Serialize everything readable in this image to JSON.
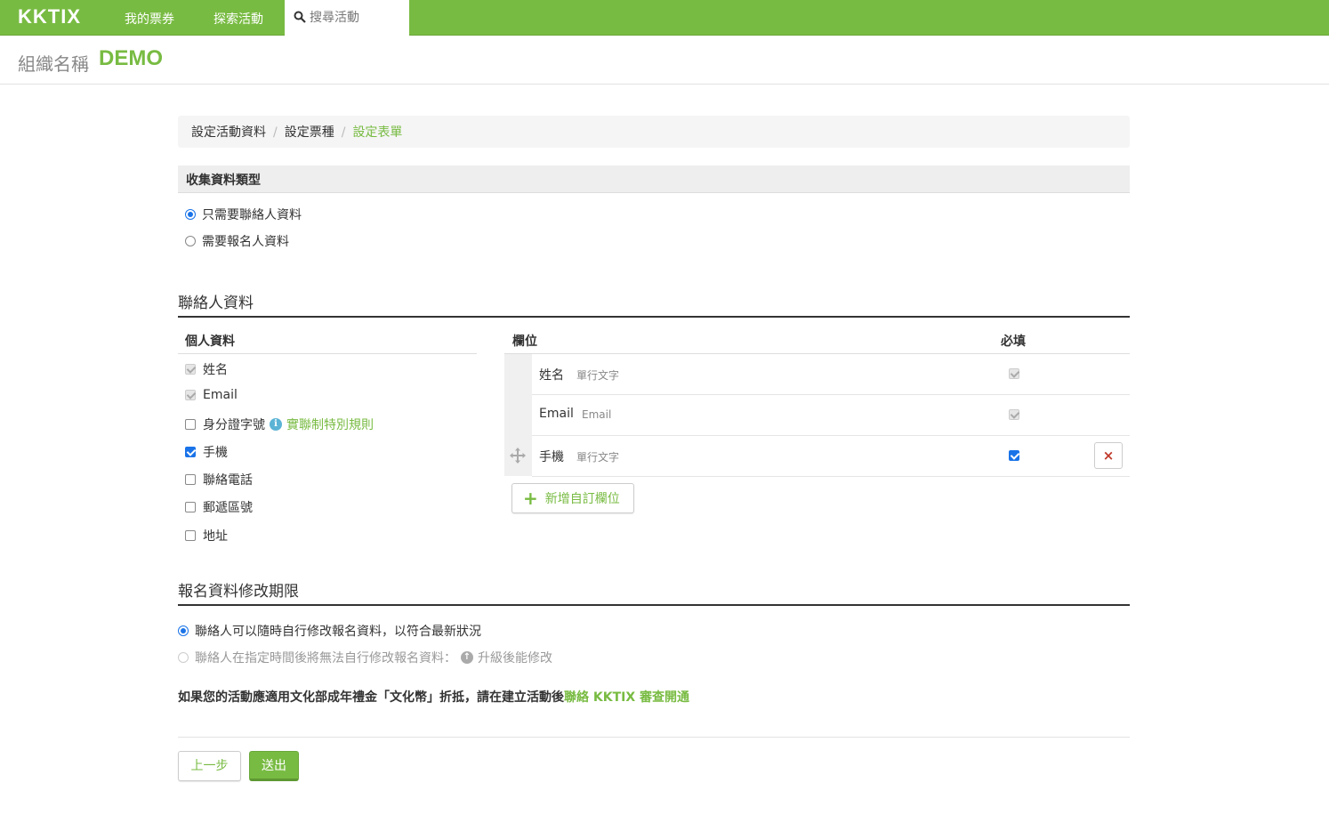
{
  "nav": {
    "logo": "KKTIX",
    "my_tickets": "我的票券",
    "explore": "探索活動",
    "search_placeholder": "搜尋活動"
  },
  "org": {
    "label": "組織名稱",
    "name": "DEMO"
  },
  "breadcrumb": {
    "step1": "設定活動資料",
    "step2": "設定票種",
    "step3": "設定表單",
    "separator": "/"
  },
  "collect_type": {
    "title": "收集資料類型",
    "options": [
      {
        "label": "只需要聯絡人資料",
        "selected": true
      },
      {
        "label": "需要報名人資料",
        "selected": false
      }
    ]
  },
  "contact": {
    "title": "聯絡人資料",
    "personal_header": "個人資料",
    "fields_header": "欄位",
    "required_header": "必填",
    "checklist": [
      {
        "label": "姓名",
        "state": "checked-disabled"
      },
      {
        "label": "Email",
        "state": "checked-disabled"
      },
      {
        "label": "身分證字號",
        "state": "unchecked",
        "info_link": "實聯制特別規則"
      },
      {
        "label": "手機",
        "state": "checked"
      },
      {
        "label": "聯絡電話",
        "state": "unchecked"
      },
      {
        "label": "郵遞區號",
        "state": "unchecked"
      },
      {
        "label": "地址",
        "state": "unchecked"
      }
    ],
    "field_rows": [
      {
        "name": "姓名",
        "type": "單行文字",
        "required": "checked-disabled"
      },
      {
        "name": "Email",
        "type": "Email",
        "required": "checked-disabled"
      },
      {
        "name": "手機",
        "type": "單行文字",
        "required": "checked"
      }
    ],
    "add_field_label": "新增自訂欄位",
    "remove_label": "×"
  },
  "modify_period": {
    "title": "報名資料修改期限",
    "options": [
      {
        "label": "聯絡人可以隨時自行修改報名資料，以符合最新狀況",
        "selected": true
      },
      {
        "label": "聯絡人在指定時間後將無法自行修改報名資料：",
        "selected": false,
        "disabled": true,
        "upgrade_text": "升級後能修改"
      }
    ]
  },
  "notice": {
    "text": "如果您的活動應適用文化部成年禮金「文化幣」折抵，請在建立活動後",
    "link": "聯絡 KKTIX 審查開通"
  },
  "footer": {
    "prev_label": "上一步",
    "submit_label": "送出"
  },
  "colors": {
    "brand_green": "#78bb42",
    "checkbox_blue": "#1a73e8",
    "remove_red": "#c0392b"
  }
}
